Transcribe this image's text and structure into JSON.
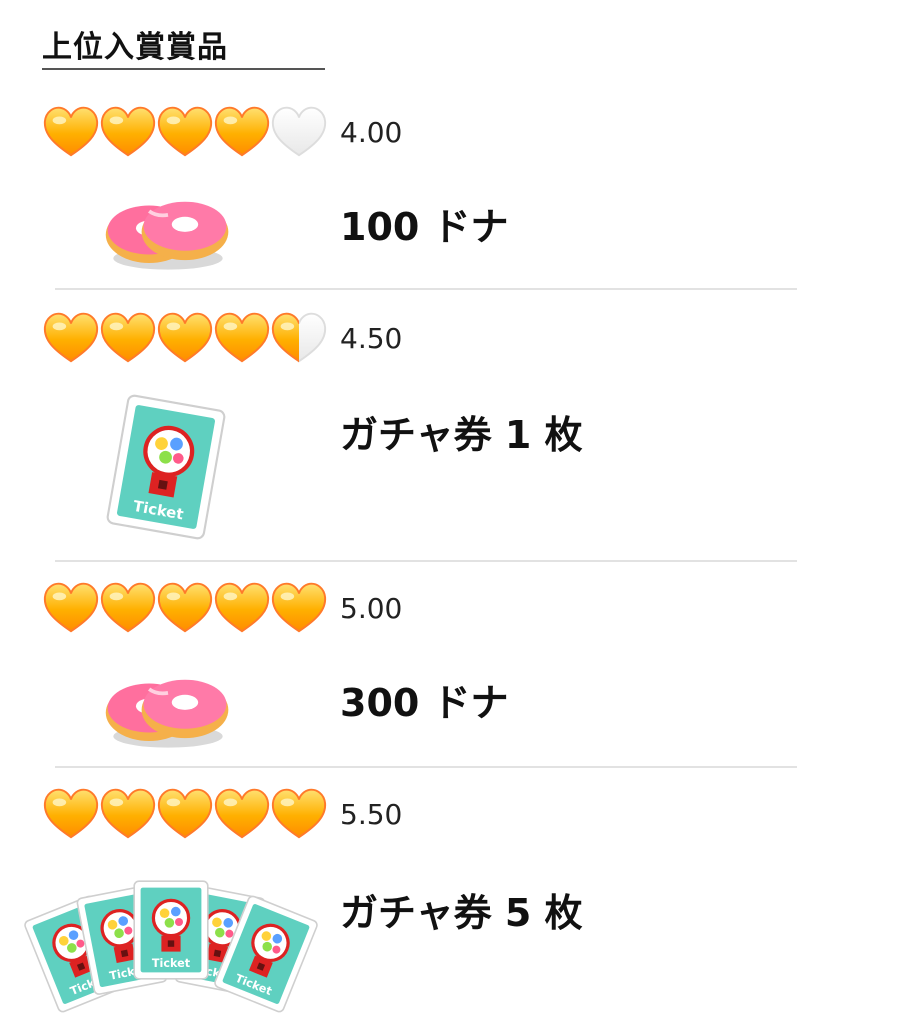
{
  "section": {
    "title": "上位入賞賞品"
  },
  "tiers": [
    {
      "score": "4.00",
      "hearts": [
        1,
        1,
        1,
        1,
        0
      ],
      "prize_label": "100 ドナ",
      "prize_icon": "donut-icon"
    },
    {
      "score": "4.50",
      "hearts": [
        1,
        1,
        1,
        1,
        0.5
      ],
      "prize_label": "ガチャ券 1 枚",
      "prize_icon": "gacha-ticket-icon"
    },
    {
      "score": "5.00",
      "hearts": [
        1,
        1,
        1,
        1,
        1
      ],
      "prize_label": "300 ドナ",
      "prize_icon": "donut-icon"
    },
    {
      "score": "5.50",
      "hearts": [
        1,
        1,
        1,
        1,
        1
      ],
      "prize_label": "ガチャ券 5 枚",
      "prize_icon": "gacha-ticket-fan-icon"
    }
  ],
  "ticket_text": "Ticket",
  "colors": {
    "heart_gold": "#ffb300",
    "heart_empty": "#f3f3f3",
    "donut_pink": "#ff6f9e",
    "ticket_teal": "#5fd0c0"
  }
}
